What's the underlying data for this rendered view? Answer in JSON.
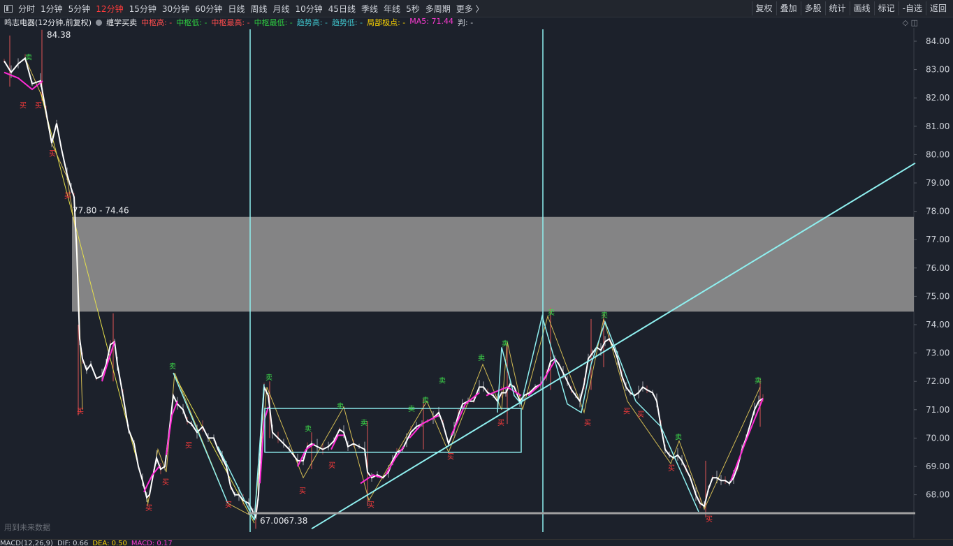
{
  "toolbar": {
    "periods": [
      "分时",
      "1分钟",
      "5分钟",
      "12分钟",
      "15分钟",
      "30分钟",
      "60分钟",
      "日线",
      "周线",
      "月线",
      "10分钟",
      "45日线",
      "季线",
      "年线",
      "5秒",
      "多周期",
      "更多 〉"
    ],
    "active_period": "12分钟",
    "right_buttons": [
      "复权",
      "叠加",
      "多股",
      "统计",
      "画线",
      "标记",
      "-自选",
      "返回"
    ]
  },
  "info": {
    "title": "鸣志电器(12分钟,前复权)",
    "indicator": "缠学买卖",
    "items": [
      {
        "label": "中枢高: -",
        "color": "#ff4d4d"
      },
      {
        "label": "中枢低: -",
        "color": "#2ecc40"
      },
      {
        "label": "中枢最高: -",
        "color": "#ff4d4d"
      },
      {
        "label": "中枢最低: -",
        "color": "#2ecc40"
      },
      {
        "label": "趋势高: -",
        "color": "#3fc1c9"
      },
      {
        "label": "趋势低: -",
        "color": "#3fc1c9"
      },
      {
        "label": "局部极点: -",
        "color": "#ffd700"
      },
      {
        "label": "MA5: 71.44",
        "color": "#ff3bd5"
      },
      {
        "label": "判: -",
        "color": "#cfd3da"
      }
    ]
  },
  "chart_data": {
    "type": "candlestick",
    "ylim": [
      66.5,
      84.4
    ],
    "y_ticks": [
      "84.00",
      "83.00",
      "82.00",
      "81.00",
      "80.00",
      "79.00",
      "78.00",
      "77.00",
      "76.00",
      "75.00",
      "74.00",
      "73.00",
      "72.00",
      "71.00",
      "70.00",
      "69.00",
      "68.00"
    ],
    "annotations": {
      "high_label": "84.38",
      "low_label": "67.00",
      "low_label2": "67.38",
      "zone_label": "77.80 - 74.46",
      "zone_top": 77.8,
      "zone_bottom": 74.46
    },
    "price_path": [
      [
        0,
        83.3
      ],
      [
        10,
        82.9
      ],
      [
        20,
        83.2
      ],
      [
        30,
        83.4
      ],
      [
        40,
        82.5
      ],
      [
        52,
        82.6
      ],
      [
        60,
        81.5
      ],
      [
        68,
        80.4
      ],
      [
        75,
        81.1
      ],
      [
        82,
        80.2
      ],
      [
        90,
        79.3
      ],
      [
        96,
        78.8
      ],
      [
        100,
        78.5
      ],
      [
        104,
        76.5
      ],
      [
        108,
        73.5
      ],
      [
        112,
        72.8
      ],
      [
        118,
        72.4
      ],
      [
        124,
        72.6
      ],
      [
        132,
        72.1
      ],
      [
        140,
        72.2
      ],
      [
        146,
        72.6
      ],
      [
        152,
        73.3
      ],
      [
        158,
        73.4
      ],
      [
        162,
        72.6
      ],
      [
        170,
        71.5
      ],
      [
        178,
        70.3
      ],
      [
        186,
        69.8
      ],
      [
        192,
        69.0
      ],
      [
        198,
        68.5
      ],
      [
        204,
        67.9
      ],
      [
        208,
        68.0
      ],
      [
        214,
        68.8
      ],
      [
        218,
        69.3
      ],
      [
        224,
        68.9
      ],
      [
        230,
        69.0
      ],
      [
        236,
        70.2
      ],
      [
        242,
        71.5
      ],
      [
        248,
        71.2
      ],
      [
        256,
        71.0
      ],
      [
        262,
        70.6
      ],
      [
        268,
        70.5
      ],
      [
        276,
        70.2
      ],
      [
        284,
        70.4
      ],
      [
        292,
        70.0
      ],
      [
        300,
        70.0
      ],
      [
        306,
        69.6
      ],
      [
        312,
        69.3
      ],
      [
        318,
        69.0
      ],
      [
        324,
        68.3
      ],
      [
        330,
        68.0
      ],
      [
        336,
        68.0
      ],
      [
        342,
        67.8
      ],
      [
        350,
        67.7
      ],
      [
        356,
        67.4
      ],
      [
        360,
        67.2
      ],
      [
        364,
        68.0
      ],
      [
        368,
        70.3
      ],
      [
        372,
        71.8
      ],
      [
        378,
        71.5
      ],
      [
        384,
        70.2
      ],
      [
        392,
        70.0
      ],
      [
        400,
        69.8
      ],
      [
        408,
        69.6
      ],
      [
        414,
        69.4
      ],
      [
        420,
        69.2
      ],
      [
        428,
        69.2
      ],
      [
        434,
        69.7
      ],
      [
        440,
        69.8
      ],
      [
        448,
        69.7
      ],
      [
        456,
        69.6
      ],
      [
        464,
        69.7
      ],
      [
        472,
        69.9
      ],
      [
        480,
        70.3
      ],
      [
        486,
        70.2
      ],
      [
        492,
        69.7
      ],
      [
        500,
        69.8
      ],
      [
        508,
        69.7
      ],
      [
        516,
        69.6
      ],
      [
        520,
        68.8
      ],
      [
        526,
        68.6
      ],
      [
        534,
        68.7
      ],
      [
        542,
        68.6
      ],
      [
        550,
        68.8
      ],
      [
        556,
        69.2
      ],
      [
        562,
        69.5
      ],
      [
        570,
        69.6
      ],
      [
        576,
        69.9
      ],
      [
        582,
        70.2
      ],
      [
        590,
        70.4
      ],
      [
        598,
        70.5
      ],
      [
        606,
        70.6
      ],
      [
        614,
        70.7
      ],
      [
        622,
        70.9
      ],
      [
        628,
        70.5
      ],
      [
        636,
        69.8
      ],
      [
        644,
        70.3
      ],
      [
        650,
        70.8
      ],
      [
        656,
        71.2
      ],
      [
        664,
        71.3
      ],
      [
        672,
        71.3
      ],
      [
        680,
        71.8
      ],
      [
        686,
        71.8
      ],
      [
        692,
        71.6
      ],
      [
        700,
        71.5
      ],
      [
        706,
        71.3
      ],
      [
        712,
        71.6
      ],
      [
        718,
        71.6
      ],
      [
        724,
        71.9
      ],
      [
        730,
        71.8
      ],
      [
        738,
        71.3
      ],
      [
        744,
        71.5
      ],
      [
        752,
        71.6
      ],
      [
        760,
        71.8
      ],
      [
        768,
        71.9
      ],
      [
        776,
        72.2
      ],
      [
        782,
        72.7
      ],
      [
        788,
        72.8
      ],
      [
        794,
        72.6
      ],
      [
        800,
        72.3
      ],
      [
        806,
        72.0
      ],
      [
        812,
        71.7
      ],
      [
        818,
        71.5
      ],
      [
        824,
        71.3
      ],
      [
        830,
        71.9
      ],
      [
        836,
        72.8
      ],
      [
        842,
        73.0
      ],
      [
        848,
        73.2
      ],
      [
        854,
        73.1
      ],
      [
        860,
        73.4
      ],
      [
        866,
        73.5
      ],
      [
        872,
        73.2
      ],
      [
        878,
        72.8
      ],
      [
        884,
        72.2
      ],
      [
        890,
        71.8
      ],
      [
        896,
        71.6
      ],
      [
        902,
        71.5
      ],
      [
        908,
        71.6
      ],
      [
        914,
        71.8
      ],
      [
        920,
        71.7
      ],
      [
        928,
        71.6
      ],
      [
        934,
        71.3
      ],
      [
        940,
        70.4
      ],
      [
        946,
        69.6
      ],
      [
        952,
        69.4
      ],
      [
        958,
        69.3
      ],
      [
        964,
        69.4
      ],
      [
        970,
        69.2
      ],
      [
        976,
        68.9
      ],
      [
        982,
        68.6
      ],
      [
        990,
        68.0
      ],
      [
        996,
        67.7
      ],
      [
        1002,
        67.6
      ],
      [
        1008,
        68.2
      ],
      [
        1014,
        68.6
      ],
      [
        1020,
        68.6
      ],
      [
        1026,
        68.5
      ],
      [
        1032,
        68.5
      ],
      [
        1038,
        68.4
      ],
      [
        1044,
        68.6
      ],
      [
        1050,
        69.0
      ],
      [
        1056,
        69.6
      ],
      [
        1062,
        70.0
      ],
      [
        1068,
        70.5
      ],
      [
        1074,
        71.0
      ],
      [
        1080,
        71.3
      ],
      [
        1086,
        71.4
      ]
    ],
    "ma5_segments": [
      [
        [
          0,
          82.9
        ],
        [
          20,
          82.7
        ],
        [
          40,
          82.3
        ],
        [
          55,
          82.6
        ]
      ],
      [
        [
          140,
          72.0
        ],
        [
          150,
          72.8
        ],
        [
          158,
          73.4
        ]
      ],
      [
        [
          200,
          68.1
        ],
        [
          212,
          68.7
        ],
        [
          222,
          69.0
        ]
      ],
      [
        [
          232,
          69.4
        ],
        [
          240,
          70.8
        ],
        [
          248,
          71.3
        ]
      ],
      [
        [
          366,
          68.4
        ],
        [
          372,
          70.6
        ],
        [
          378,
          71.1
        ]
      ],
      [
        [
          420,
          69.0
        ],
        [
          432,
          69.6
        ],
        [
          444,
          69.8
        ]
      ],
      [
        [
          468,
          69.6
        ],
        [
          478,
          70.1
        ],
        [
          486,
          70.1
        ]
      ],
      [
        [
          510,
          68.4
        ],
        [
          528,
          68.7
        ],
        [
          540,
          68.6
        ]
      ],
      [
        [
          546,
          68.7
        ],
        [
          560,
          69.3
        ],
        [
          572,
          69.7
        ]
      ],
      [
        [
          580,
          70.0
        ],
        [
          598,
          70.5
        ],
        [
          622,
          70.8
        ]
      ],
      [
        [
          640,
          70.1
        ],
        [
          660,
          71.2
        ],
        [
          680,
          71.6
        ]
      ],
      [
        [
          690,
          71.5
        ],
        [
          720,
          71.8
        ],
        [
          740,
          71.5
        ]
      ],
      [
        [
          750,
          71.5
        ],
        [
          768,
          71.9
        ],
        [
          790,
          72.8
        ]
      ],
      [
        [
          1040,
          68.5
        ],
        [
          1060,
          69.8
        ],
        [
          1086,
          71.4
        ]
      ]
    ],
    "bi_lines": [
      [
        [
          30,
          83.4
        ],
        [
          55,
          82.0
        ],
        [
          68,
          80.4
        ],
        [
          90,
          79.2
        ],
        [
          104,
          77.0
        ],
        [
          112,
          71.0
        ]
      ],
      [
        [
          205,
          67.6
        ],
        [
          220,
          69.6
        ],
        [
          232,
          68.8
        ],
        [
          244,
          72.3
        ],
        [
          320,
          67.7
        ],
        [
          358,
          67.2
        ],
        [
          376,
          71.8
        ],
        [
          428,
          68.6
        ],
        [
          486,
          71.1
        ],
        [
          522,
          67.8
        ],
        [
          605,
          71.3
        ],
        [
          636,
          69.5
        ],
        [
          685,
          72.6
        ],
        [
          712,
          71.0
        ],
        [
          720,
          73.4
        ],
        [
          742,
          71.0
        ],
        [
          778,
          74.3
        ],
        [
          830,
          70.9
        ],
        [
          858,
          74.2
        ],
        [
          892,
          71.3
        ],
        [
          954,
          69.1
        ],
        [
          966,
          69.9
        ],
        [
          1002,
          67.5
        ],
        [
          1082,
          71.8
        ]
      ]
    ],
    "trend_lines": [
      [
        [
          52,
          82.2
        ],
        [
          206,
          67.7
        ]
      ],
      [
        [
          242,
          72.3
        ],
        [
          358,
          67.0
        ]
      ]
    ],
    "signals": {
      "sell": [
        [
          36,
          83.3
        ],
        [
          242,
          72.4
        ],
        [
          380,
          72.0
        ],
        [
          436,
          70.2
        ],
        [
          482,
          71.0
        ],
        [
          516,
          70.4
        ],
        [
          584,
          70.9
        ],
        [
          604,
          71.2
        ],
        [
          628,
          71.9
        ],
        [
          684,
          72.7
        ],
        [
          718,
          73.2
        ],
        [
          784,
          74.3
        ],
        [
          860,
          74.2
        ],
        [
          966,
          69.9
        ],
        [
          1080,
          71.9
        ]
      ],
      "buy": [
        [
          28,
          81.9
        ],
        [
          50,
          81.9
        ],
        [
          70,
          80.2
        ],
        [
          92,
          78.7
        ],
        [
          110,
          71.1
        ],
        [
          208,
          67.7
        ],
        [
          232,
          68.6
        ],
        [
          265,
          69.9
        ],
        [
          322,
          67.8
        ],
        [
          428,
          68.3
        ],
        [
          470,
          69.2
        ],
        [
          526,
          67.8
        ],
        [
          640,
          69.5
        ],
        [
          712,
          70.7
        ],
        [
          836,
          70.7
        ],
        [
          892,
          71.1
        ],
        [
          912,
          71.0
        ],
        [
          956,
          69.1
        ],
        [
          1010,
          67.3
        ]
      ]
    },
    "volatility_spikes": [
      [
        8,
        84.2,
        82.4
      ],
      [
        54,
        84.4,
        81.9
      ],
      [
        106,
        74.0,
        70.8
      ],
      [
        156,
        74.4,
        72.0
      ],
      [
        360,
        67.9,
        66.8
      ],
      [
        380,
        72.0,
        70.0
      ],
      [
        440,
        70.2,
        68.9
      ],
      [
        520,
        70.6,
        67.6
      ],
      [
        600,
        71.4,
        69.6
      ],
      [
        720,
        73.4,
        70.5
      ],
      [
        782,
        74.6,
        71.7
      ],
      [
        840,
        74.2,
        71.7
      ],
      [
        858,
        74.4,
        72.5
      ],
      [
        1004,
        69.2,
        67.2
      ],
      [
        1082,
        72.1,
        70.4
      ]
    ]
  },
  "status": "用到未来数据",
  "bottom": {
    "items": [
      {
        "label": "MACD(12,26,9)",
        "color": "#cfd3da"
      },
      {
        "label": "DIF: 0.66",
        "color": "#cfd3da"
      },
      {
        "label": "DEA: 0.50",
        "color": "#ffd700"
      },
      {
        "label": "MACD: 0.17",
        "color": "#ff3bd5"
      }
    ]
  }
}
